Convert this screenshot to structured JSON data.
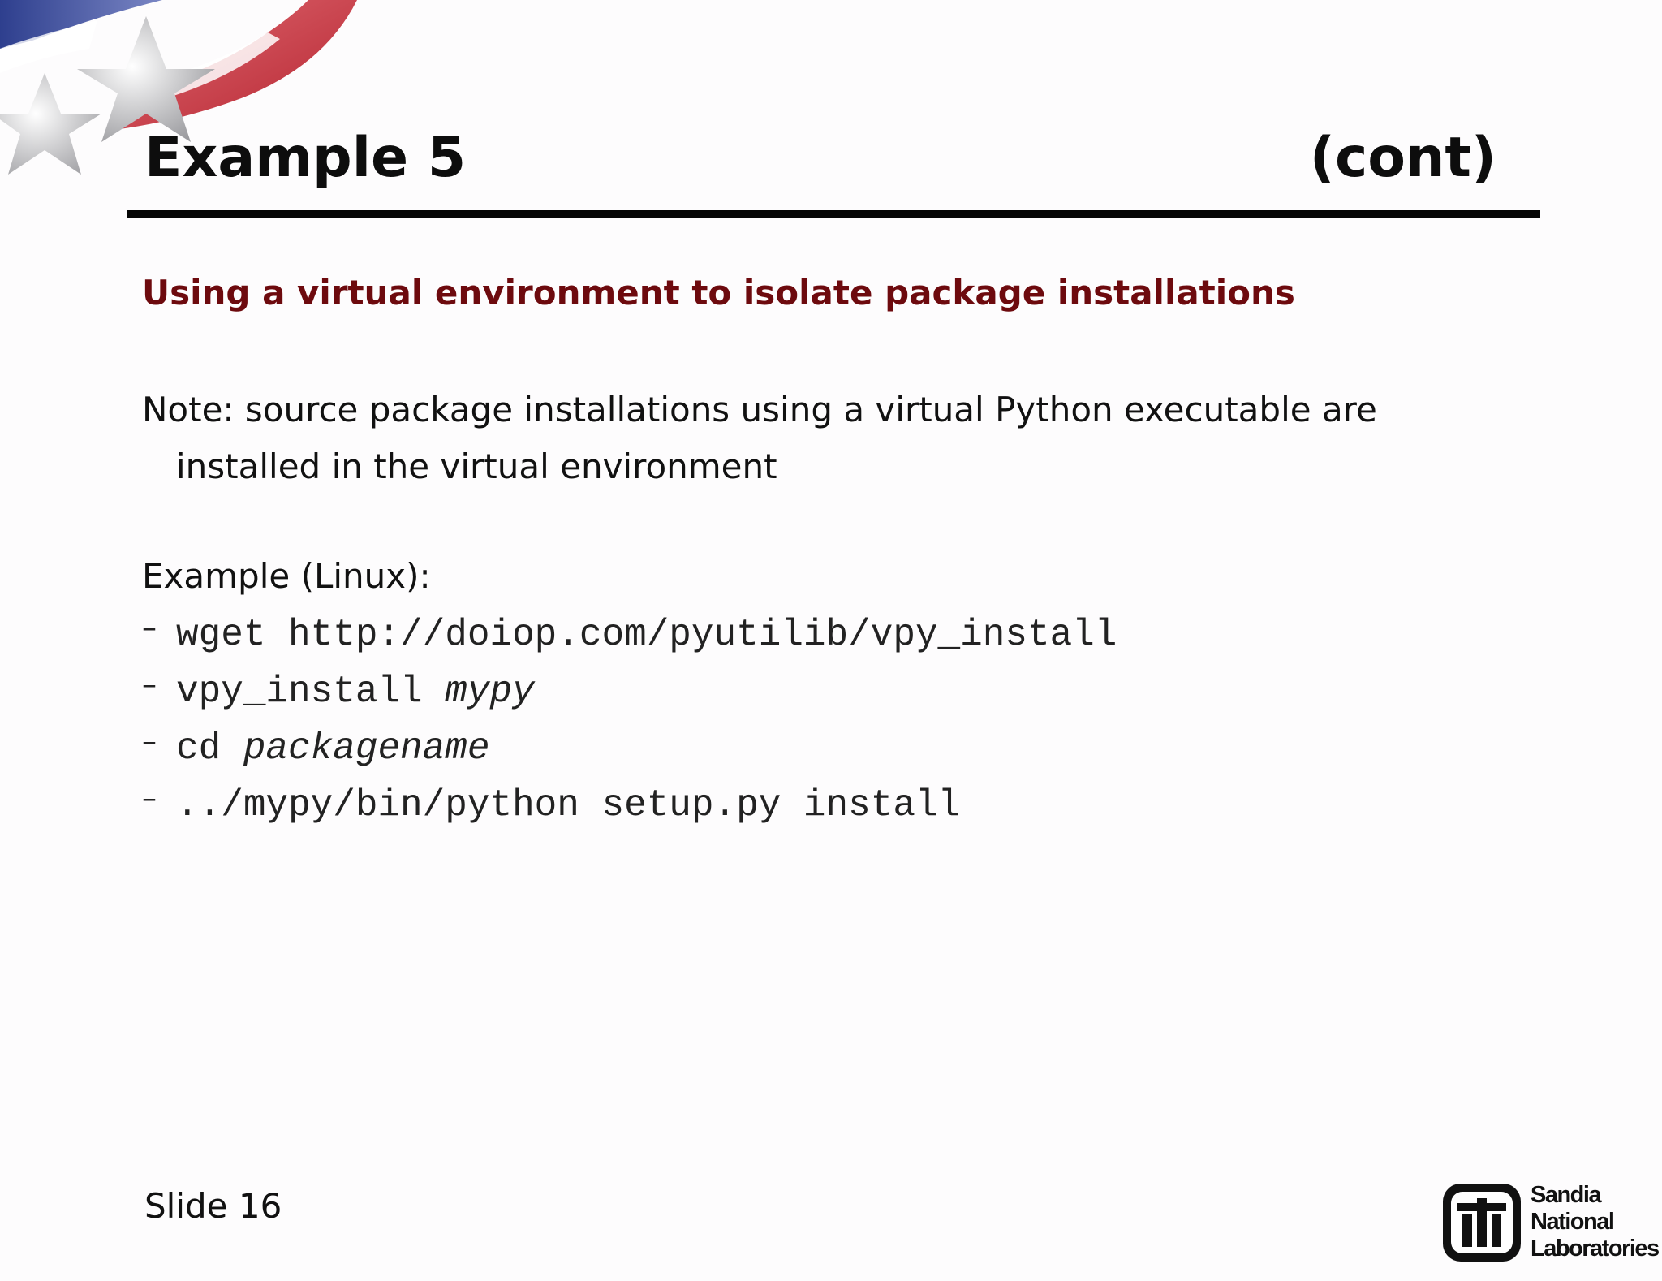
{
  "slide": {
    "title_left": "Example 5",
    "title_right": "(cont)",
    "subtitle": "Using a virtual environment to isolate package installations",
    "note_line1": "Note: source package installations using a virtual Python executable are",
    "note_line2": "installed in the virtual environment",
    "example_label": "Example (Linux):",
    "commands": [
      {
        "dash": "–",
        "code": "wget http://doiop.com/pyutilib/vpy_install",
        "arg": ""
      },
      {
        "dash": "–",
        "code": "vpy_install ",
        "arg": "mypy"
      },
      {
        "dash": "–",
        "code": "cd ",
        "arg": "packagename"
      },
      {
        "dash": "–",
        "code": "../mypy/bin/python setup.py install",
        "arg": ""
      }
    ],
    "slide_number": "Slide 16"
  },
  "footer_logo": {
    "line1": "Sandia",
    "line2": "National",
    "line3": "Laboratories",
    "icon": "sandia-thunderbird-icon"
  },
  "colors": {
    "subtitle": "#6d0a0e",
    "rule": "#060606",
    "flag_red": "#c8323c",
    "flag_blue": "#3c4c9a"
  }
}
